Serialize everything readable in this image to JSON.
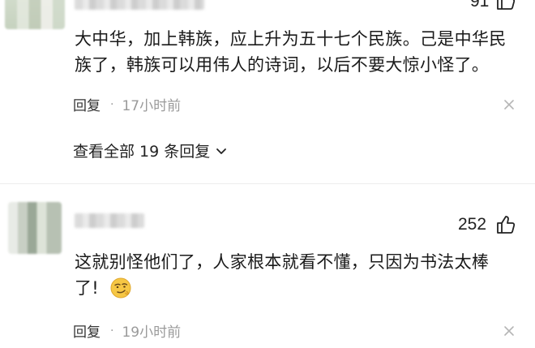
{
  "comments": [
    {
      "like_count": "91",
      "text_line1": "大中华，加上韩族，应上升为五十七个民族。己是中华民",
      "text_line2": "族了，韩族可以用伟人的诗词，以后不要大惊小怪了。",
      "reply_label": "回复",
      "separator": "·",
      "time": "17小时前",
      "view_replies_label": "查看全部 19 条回复"
    },
    {
      "like_count": "252",
      "text_line1": "这就别怪他们了，人家根本就看不懂，只因为书法太棒",
      "text_line2": "了!",
      "reply_label": "回复",
      "separator": "·",
      "time": "19小时前"
    }
  ],
  "icons": {
    "like": "thumbs-up-icon",
    "close": "close-icon",
    "chevron": "chevron-down-icon",
    "emoji": "smirk-emoji-icon"
  },
  "colors": {
    "text": "#1a1a1a",
    "meta": "#9a9a9a",
    "emoji": "#f4c430"
  }
}
